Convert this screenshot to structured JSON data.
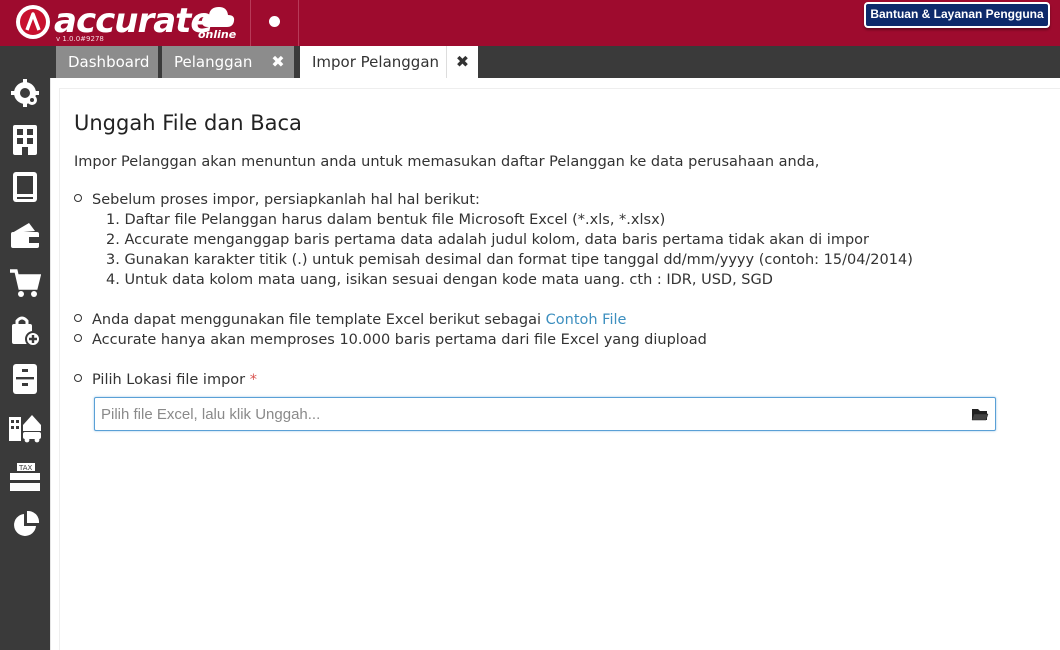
{
  "app": {
    "logo_text": "accurate",
    "logo_sub": "online",
    "version": "v 1.0.0#9278",
    "help_label": "Bantuan & Layanan Pengguna"
  },
  "tabs": [
    {
      "label": "Dashboard"
    },
    {
      "label": "Pelanggan"
    },
    {
      "label": "Impor Pelanggan"
    }
  ],
  "sidebar": {
    "icons": [
      "settings-icon",
      "company-icon",
      "ledger-icon",
      "cash-bank-icon",
      "sales-cart-icon",
      "purchase-bag-icon",
      "inventory-icon",
      "fixed-asset-icon",
      "tax-icon",
      "report-chart-icon"
    ]
  },
  "page": {
    "title": "Unggah File dan Baca",
    "intro": "Impor Pelanggan akan menuntun anda untuk memasukan daftar Pelanggan ke data perusahaan anda,",
    "prep_heading": "Sebelum proses impor, persiapkanlah hal hal berikut:",
    "prep_items": [
      "1. Daftar file Pelanggan harus dalam bentuk file Microsoft Excel (*.xls, *.xlsx)",
      "2. Accurate menganggap baris pertama data adalah judul kolom, data baris pertama tidak akan di impor",
      "3. Gunakan karakter titik (.) untuk pemisah desimal dan format tipe tanggal dd/mm/yyyy (contoh: 15/04/2014)",
      "4. Untuk data kolom mata uang, isikan sesuai dengan kode mata uang. cth : IDR, USD, SGD"
    ],
    "template_text": "Anda dapat menggunakan file template Excel berikut sebagai",
    "template_link": "Contoh File",
    "limit_text": "Accurate hanya akan memproses 10.000 baris pertama dari file Excel yang diupload",
    "file_label": "Pilih Lokasi file impor",
    "required_mark": "*",
    "file_placeholder": "Pilih file Excel, lalu klik Unggah..."
  },
  "colors": {
    "brand": "#9e0b2e",
    "sidebar": "#3a3a3a",
    "link": "#3d8fbf",
    "help_button": "#0d2a6b"
  }
}
